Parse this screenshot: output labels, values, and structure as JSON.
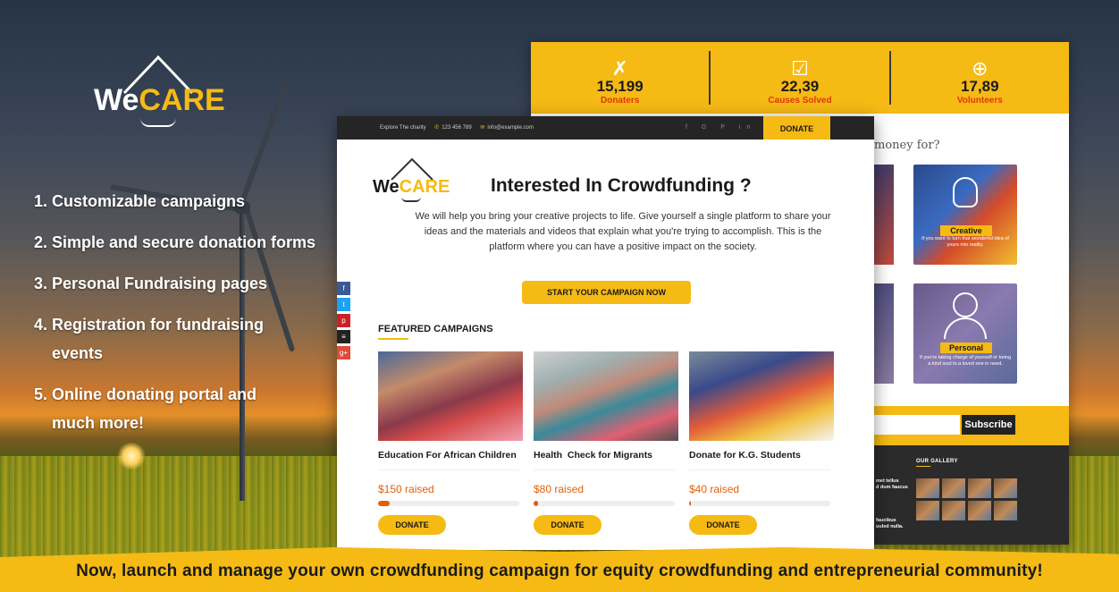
{
  "brand": {
    "we": "We",
    "care": "CARE"
  },
  "features": [
    "1. Customizable campaigns",
    "2. Simple and secure donation forms",
    "3. Personal Fundraising pages",
    "4. Registration for fundraising",
    "events",
    "5. Online donating portal and",
    "much more!"
  ],
  "stats": [
    {
      "icon": "ribbon-icon",
      "glyph": "✗",
      "value": "15,199",
      "label": "Donaters"
    },
    {
      "icon": "checkbox-icon",
      "glyph": "☑",
      "value": "22,39",
      "label": "Causes Solved"
    },
    {
      "icon": "globe-icon",
      "glyph": "⊕",
      "value": "17,89",
      "label": "Volunteers"
    }
  ],
  "back": {
    "money_text": "money for?",
    "tile_creative": {
      "label": "Creative",
      "desc": "If you want to turn that wonderful idea of yours into reality."
    },
    "tile_personal": {
      "label": "Personal",
      "desc": "If you're taking charge of yourself or being a kind soul to a loved one in need."
    },
    "subscribe": "Subscribe",
    "gallery_title": "OUR GALLERY",
    "foot_t1": "met tellus\nd dum faucus",
    "foot_t2": "faucibus\nuuled nulla."
  },
  "topbar": {
    "explore": "Explore The charity",
    "phone": "123 456 789",
    "email": "info@example.com",
    "socials": "f G P in ♥",
    "donate": "DONATE"
  },
  "hero": {
    "heading": "Interested In Crowdfunding ?",
    "para": "We will help you bring your creative projects to life. Give yourself a single platform to share your ideas and the materials and videos that explain what you're trying to accomplish. This is the platform where you can have a positive impact on the society.",
    "cta": "START YOUR CAMPAIGN NOW"
  },
  "featured_title": "FEATURED CAMPAIGNS",
  "campaigns": [
    {
      "title": "Education For African Children",
      "raised": "$150 raised",
      "progress": 0.08,
      "button": "DONATE"
    },
    {
      "title": "Health  Check for Migrants",
      "raised": "$80 raised",
      "progress": 0.03,
      "button": "DONATE"
    },
    {
      "title": "Donate for K.G. Students",
      "raised": "$40 raised",
      "progress": 0.01,
      "button": "DONATE"
    }
  ],
  "social_stack": [
    {
      "name": "facebook-icon",
      "glyph": "f",
      "color": "#3b5998"
    },
    {
      "name": "twitter-icon",
      "glyph": "t",
      "color": "#1da1f2"
    },
    {
      "name": "pinterest-icon",
      "glyph": "p",
      "color": "#cb2027"
    },
    {
      "name": "stack-icon",
      "glyph": "≡",
      "color": "#222222"
    },
    {
      "name": "google-plus-icon",
      "glyph": "g+",
      "color": "#dd4b39"
    }
  ],
  "tagline": "Now, launch and manage your own crowdfunding campaign for equity crowdfunding and entrepreneurial community!",
  "colors": {
    "accent": "#f6ba14",
    "orange": "#e0600a",
    "dark": "#252525"
  }
}
